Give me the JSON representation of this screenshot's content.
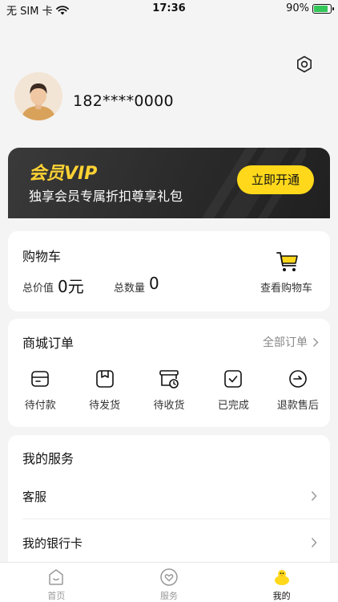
{
  "status_bar": {
    "carrier": "无 SIM 卡",
    "time": "17:36",
    "battery": "90%",
    "battery_level": 0.9
  },
  "profile": {
    "phone": "182****0000"
  },
  "vip": {
    "title": "会员VIP",
    "subtitle": "独享会员专属折扣尊享礼包",
    "button": "立即开通"
  },
  "cart": {
    "title": "购物车",
    "total_price_label": "总价值",
    "total_price_value": "0元",
    "total_count_label": "总数量",
    "total_count_value": "0",
    "view_label": "查看购物车"
  },
  "orders": {
    "title": "商城订单",
    "all_label": "全部订单",
    "items": [
      {
        "label": "待付款",
        "icon": "wallet-icon"
      },
      {
        "label": "待发货",
        "icon": "box-icon"
      },
      {
        "label": "待收货",
        "icon": "delivery-icon"
      },
      {
        "label": "已完成",
        "icon": "check-icon"
      },
      {
        "label": "退款售后",
        "icon": "refund-icon"
      }
    ]
  },
  "services": {
    "title": "我的服务",
    "items": [
      {
        "label": "客服"
      },
      {
        "label": "我的银行卡"
      }
    ]
  },
  "tabbar": {
    "items": [
      {
        "label": "首页",
        "icon": "home-icon"
      },
      {
        "label": "服务",
        "icon": "heart-icon"
      },
      {
        "label": "我的",
        "icon": "duck-icon"
      }
    ],
    "active_index": 2
  },
  "colors": {
    "accent": "#ffd81b",
    "vip_text": "#ffd233",
    "vip_bg": "#2b2b2b"
  }
}
